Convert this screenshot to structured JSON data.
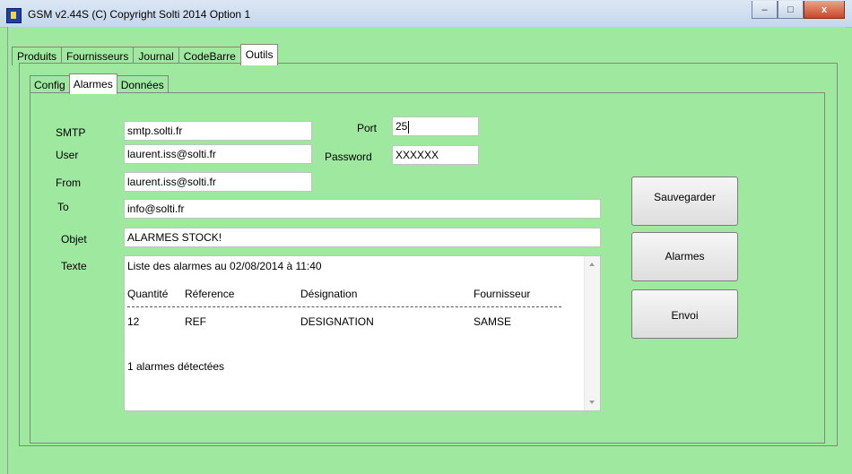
{
  "window": {
    "title": "GSM v2.44S (C) Copyright Solti 2014 Option 1",
    "controls": {
      "minimize": "–",
      "maximize": "□",
      "close": "x"
    }
  },
  "tabs": [
    "Produits",
    "Fournisseurs",
    "Journal",
    "CodeBarre",
    "Outils"
  ],
  "active_tab": "Outils",
  "subtabs": [
    "Config",
    "Alarmes",
    "Données"
  ],
  "active_subtab": "Alarmes",
  "form": {
    "smtp_label": "SMTP",
    "smtp_value": "smtp.solti.fr",
    "port_label": "Port",
    "port_value": "25",
    "user_label": "User",
    "user_value": "laurent.iss@solti.fr",
    "password_label": "Password",
    "password_value": "XXXXXX",
    "from_label": "From",
    "from_value": "laurent.iss@solti.fr",
    "to_label": "To",
    "to_value": "info@solti.fr",
    "objet_label": "Objet",
    "objet_value": "ALARMES STOCK!",
    "texte_label": "Texte"
  },
  "message": {
    "header_line": "Liste des alarmes au 02/08/2014 à 11:40",
    "columns": [
      "Quantité",
      "Réference",
      "Désignation",
      "Fournisseur"
    ],
    "rows": [
      [
        "12",
        "REF",
        "DESIGNATION",
        "SAMSE"
      ]
    ],
    "summary": "1 alarmes détectées"
  },
  "buttons": {
    "save": "Sauvegarder",
    "alarms": "Alarmes",
    "send": "Envoi"
  }
}
